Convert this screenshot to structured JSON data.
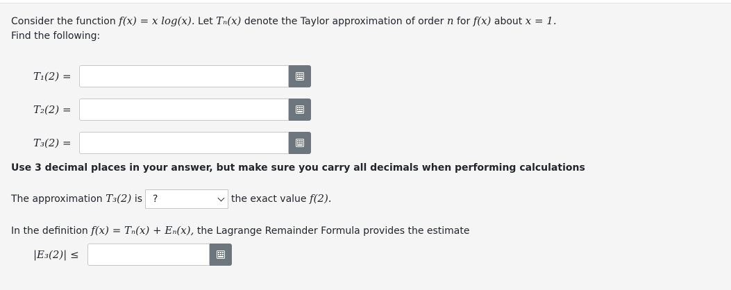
{
  "intro": {
    "consider": "Consider the function",
    "fx": "f(x) = x log(x).",
    "let": "Let",
    "tnx": "Tₙ(x)",
    "denote": "denote the Taylor approximation of order",
    "n": "n",
    "for": "for",
    "fx2": "f(x)",
    "about": "about",
    "xeq1": "x = 1.",
    "find": "Find the following:"
  },
  "answers": [
    {
      "label": "T₁(2) =",
      "value": ""
    },
    {
      "label": "T₂(2) =",
      "value": ""
    },
    {
      "label": "T₃(2) =",
      "value": ""
    }
  ],
  "instruction": "Use 3 decimal places in your answer, but make sure you carry all decimals when performing calculations",
  "comparison": {
    "prefix": "The approximation",
    "t3": "T₃(2)",
    "is": "is",
    "selected": "?",
    "suffix": "the exact value",
    "f2": "f(2)."
  },
  "lagrange": {
    "prefix": "In the definition",
    "formula": "f(x) = Tₙ(x) + Eₙ(x),",
    "suffix": "the Lagrange Remainder Formula provides the estimate",
    "bound_label": "|E₃(2)| ≤",
    "bound_value": ""
  },
  "icons": {
    "keyboard": "keyboard-icon"
  },
  "colors": {
    "panel_bg": "#f5f5f5",
    "button_bg": "#6d757d"
  }
}
